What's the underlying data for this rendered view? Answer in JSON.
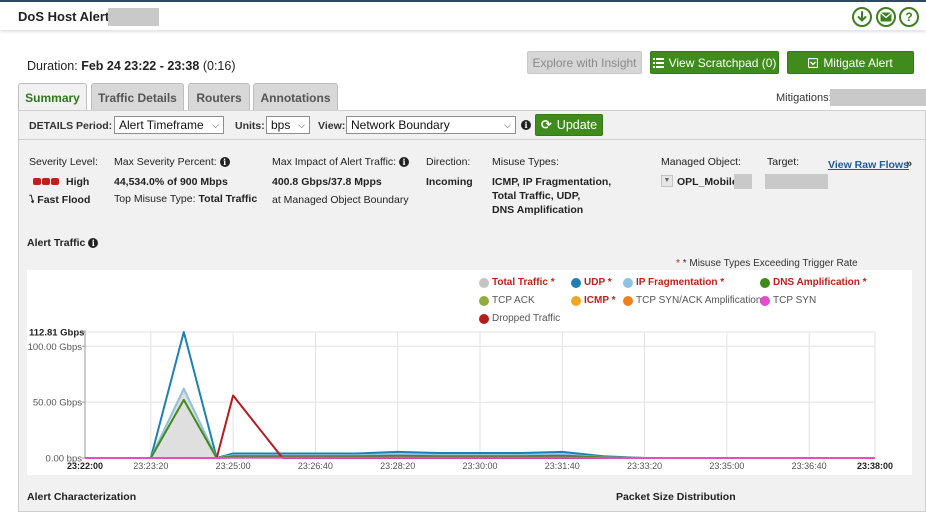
{
  "header": {
    "title": "DoS Host Alert",
    "title_suffix": "",
    "icons": [
      "download-icon",
      "mail-icon",
      "help-icon"
    ]
  },
  "duration": {
    "label": "Duration:",
    "range": "Feb 24 23:22 - 23:38",
    "length": "(0:16)"
  },
  "actions": {
    "explore": "Explore with Insight",
    "scratchpad": "View Scratchpad (0)",
    "mitigate": "Mitigate Alert"
  },
  "tabs": [
    {
      "label": "Summary",
      "active": true
    },
    {
      "label": "Traffic Details",
      "active": false
    },
    {
      "label": "Routers",
      "active": false
    },
    {
      "label": "Annotations",
      "active": false
    }
  ],
  "mitigations_label": "Mitigations:",
  "filters": {
    "details_label": "DETAILS",
    "period_label": "Period:",
    "period_value": "Alert Timeframe",
    "units_label": "Units:",
    "units_value": "bps",
    "view_label": "View:",
    "view_value": "Network Boundary",
    "update_label": "Update"
  },
  "summary": {
    "severity_label": "Severity Level:",
    "severity_value": "High",
    "flood_label": "Fast Flood",
    "max_sev_label": "Max Severity Percent:",
    "max_sev_value": "44,534.0% of 900 Mbps",
    "top_misuse_label": "Top Misuse Type:",
    "top_misuse_value": "Total Traffic",
    "max_impact_label": "Max Impact of Alert Traffic:",
    "max_impact_value": "400.8 Gbps/37.8 Mpps",
    "max_impact_note": "at Managed Object Boundary",
    "direction_label": "Direction:",
    "direction_value": "Incoming",
    "misuse_label": "Misuse Types:",
    "misuse_lines": [
      "ICMP, IP Fragmentation,",
      "Total Traffic, UDP,",
      "DNS Amplification"
    ],
    "managed_object_label": "Managed Object:",
    "managed_object_value": "OPL_Mobile",
    "target_label": "Target:",
    "view_raw_flows": "View Raw Flows",
    "view_raw_arrow": "»"
  },
  "alert_traffic_title": "Alert Traffic",
  "trigger_note": "* Misuse Types Exceeding Trigger Rate",
  "legend": [
    {
      "label": "Total Traffic *",
      "color": "#c4c4c4",
      "exceed": true
    },
    {
      "label": "UDP *",
      "color": "#1f7fb4",
      "exceed": true
    },
    {
      "label": "IP Fragmentation *",
      "color": "#8fc2e0",
      "exceed": true
    },
    {
      "label": "DNS Amplification *",
      "color": "#3f8c1c",
      "exceed": true
    },
    {
      "label": "TCP ACK",
      "color": "#8fae3e",
      "exceed": false
    },
    {
      "label": "ICMP *",
      "color": "#f2a623",
      "exceed": true
    },
    {
      "label": "TCP SYN/ACK Amplification",
      "color": "#f07f1e",
      "exceed": false
    },
    {
      "label": "TCP SYN",
      "color": "#e04fc8",
      "exceed": false
    },
    {
      "label": "Dropped Traffic",
      "color": "#b21d1d",
      "exceed": false
    }
  ],
  "chart_data": {
    "type": "area",
    "x": [
      "23:22:00",
      "23:23:20",
      "23:24:00",
      "23:24:40",
      "23:25:00",
      "23:26:00",
      "23:26:40",
      "23:27:30",
      "23:28:20",
      "23:29:10",
      "23:30:00",
      "23:30:50",
      "23:31:40",
      "23:32:30",
      "23:33:20",
      "23:34:10",
      "23:35:00",
      "23:35:50",
      "23:36:40",
      "23:37:20",
      "23:38:00"
    ],
    "x_ticks": [
      "23:22:00",
      "23:23:20",
      "23:25:00",
      "23:26:40",
      "23:28:20",
      "23:30:00",
      "23:31:40",
      "23:33:20",
      "23:35:00",
      "23:36:40",
      "23:38:00"
    ],
    "y_ticks": [
      "0.00 bps",
      "50.00 Gbps",
      "100.00 Gbps",
      "112.81 Gbps"
    ],
    "y_tick_values": [
      0,
      50,
      100,
      112.81
    ],
    "ylim": [
      0,
      112.81
    ],
    "y_unit": "Gbps",
    "series": [
      {
        "name": "Total Traffic *",
        "color": "#c4c4c4",
        "fill": true,
        "values": [
          0,
          0,
          62,
          0,
          3,
          3,
          3,
          3,
          4,
          3,
          3,
          3,
          4,
          1,
          0,
          0,
          0,
          0,
          0,
          0,
          0
        ]
      },
      {
        "name": "UDP *",
        "color": "#1f7fb4",
        "values": [
          0,
          0,
          112.81,
          0,
          4,
          4,
          4,
          4,
          5.5,
          4.5,
          4.5,
          4.5,
          5.5,
          1.5,
          0,
          0,
          0,
          0,
          0,
          0,
          0
        ]
      },
      {
        "name": "IP Fragmentation *",
        "color": "#8fc2e0",
        "values": [
          0,
          0,
          62,
          0,
          2.5,
          2.5,
          2.5,
          2.5,
          3,
          2.5,
          2.5,
          2.5,
          3,
          0.8,
          0,
          0,
          0,
          0,
          0,
          0,
          0
        ]
      },
      {
        "name": "DNS Amplification *",
        "color": "#3f8c1c",
        "values": [
          0,
          0,
          52,
          0,
          1.5,
          1.5,
          1.5,
          1.5,
          2,
          1.5,
          1.5,
          1.5,
          2,
          0.5,
          0,
          0,
          0,
          0,
          0,
          0,
          0
        ]
      },
      {
        "name": "Dropped Traffic",
        "color": "#b21d1d",
        "values": [
          0,
          0,
          0,
          0,
          56,
          0,
          0,
          0,
          0,
          0,
          0,
          0,
          0,
          0,
          0,
          0,
          0,
          0,
          0,
          0,
          0
        ]
      },
      {
        "name": "TCP SYN",
        "color": "#e04fc8",
        "values": [
          0,
          0,
          0,
          0,
          0.3,
          0.3,
          0.3,
          0.3,
          0.3,
          0.3,
          0.3,
          0.3,
          0.3,
          0.1,
          0,
          0,
          0,
          0,
          0,
          0,
          0
        ]
      }
    ]
  },
  "bottom": {
    "alert_characterization": "Alert Characterization",
    "packet_size": "Packet Size Distribution"
  }
}
